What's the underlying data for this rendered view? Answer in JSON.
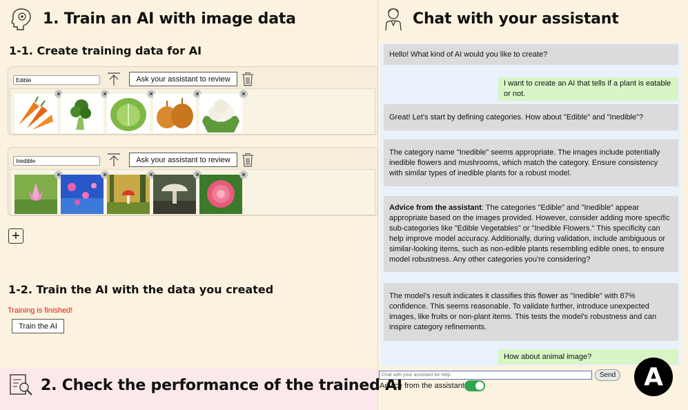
{
  "train_section": {
    "title": "1. Train an AI with image data",
    "create_title": "1-1. Create training data for AI",
    "categories": [
      {
        "name": "Edible",
        "review_label": "Ask your assistant to review",
        "images": [
          "carrots",
          "broccoli",
          "cabbage",
          "onions",
          "cauliflower"
        ]
      },
      {
        "name": "Inedible",
        "review_label": "Ask your assistant to review",
        "images": [
          "lotus-flower",
          "blue-pink-flowers",
          "forest-mushroom",
          "white-mushroom",
          "pink-dahlia"
        ]
      }
    ],
    "remove_glyph": "×",
    "add_glyph": "+",
    "train_title": "1-2. Train the AI with the data you created",
    "status_text": "Training is finished!",
    "status_color": "#e11111",
    "train_button_label": "Train the AI"
  },
  "check_section": {
    "title": "2. Check the performance of the trained AI"
  },
  "chat": {
    "title": "Chat with your assistant",
    "messages": [
      {
        "role": "assistant",
        "text": "Hello! What kind of AI would you like to create?"
      },
      {
        "role": "user",
        "text": "I want to create an AI that tells if a plant is eatable or not."
      },
      {
        "role": "assistant",
        "text": "Great! Let's start by defining categories. How about \"Edible\" and \"Inedible\"?"
      },
      {
        "role": "assistant",
        "text": "The category name \"Inedible\" seems appropriate. The images include potentially inedible flowers and mushrooms, which match the category. Ensure consistency with similar types of inedible plants for a robust model."
      },
      {
        "role": "assistant",
        "bold_prefix": "Advice from the assistant",
        "text": ": The categories \"Edible\" and \"Inedible\" appear appropriate based on the images provided. However, consider adding more specific sub-categories like \"Edible Vegetables\" or \"Inedible Flowers.\" This specificity can help improve model accuracy. Additionally, during validation, include ambiguous or similar-looking items, such as non-edible plants resembling edible ones, to ensure model robustness. Any other categories you're considering?"
      },
      {
        "role": "assistant",
        "text": "The model's result indicates it classifies this flower as \"Inedible\" with 87% confidence. This seems reasonable. To validate further, introduce unexpected images, like fruits or non-plant items. This tests the model's robustness and can inspire category refinements."
      },
      {
        "role": "user",
        "text": "How about animal image?"
      }
    ],
    "input_placeholder": "Chat with your assistant for help.",
    "send_label": "Send",
    "advice_toggle_label": "Advice from the assistant",
    "advice_toggle_on": true
  },
  "badge": "A",
  "colors": {
    "panel_bg": "#fbf3df",
    "chat_bg": "#eaf1fb",
    "assistant_bubble": "#dbdbdb",
    "user_bubble": "#d8f5c6",
    "check_band": "#fbe8ea",
    "toggle_on": "#2ea44f"
  }
}
